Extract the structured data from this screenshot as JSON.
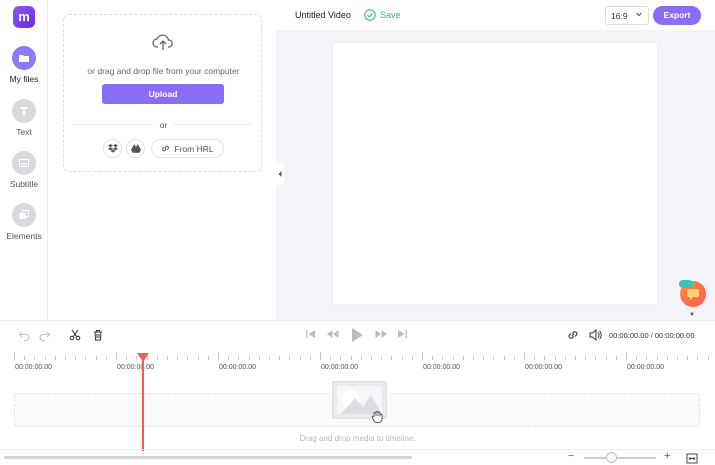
{
  "sidebar": {
    "logo": "m",
    "items": [
      {
        "label": "My files",
        "icon": "folder-icon",
        "active": true
      },
      {
        "label": "Text",
        "icon": "text-icon",
        "active": false
      },
      {
        "label": "Subtitle",
        "icon": "subtitle-icon",
        "active": false
      },
      {
        "label": "Elements",
        "icon": "elements-icon",
        "active": false
      }
    ]
  },
  "upload": {
    "drop_text": "or drag and drop file from your computer",
    "upload_label": "Upload",
    "or_label": "or",
    "url_label": "From HRL"
  },
  "header": {
    "title": "Untitled Video",
    "save_label": "Save",
    "ratio": "16:9",
    "export_label": "Export"
  },
  "player": {
    "timecode": "00:00:00.00 / 00:00:00.00"
  },
  "timeline": {
    "tick_labels": [
      "00:00:00.00",
      "00:00:00.00",
      "00:00:00.00",
      "00:00:00.00",
      "00:00:00.00",
      "00:00:00.00",
      "00:00:00.00"
    ],
    "drop_hint": "Drag and drop media to timeline.",
    "zoom_minus": "−",
    "zoom_plus": "+"
  },
  "colors": {
    "accent": "#8b6cf6",
    "save_green": "#2fbf71",
    "playhead": "#f25a5a"
  }
}
